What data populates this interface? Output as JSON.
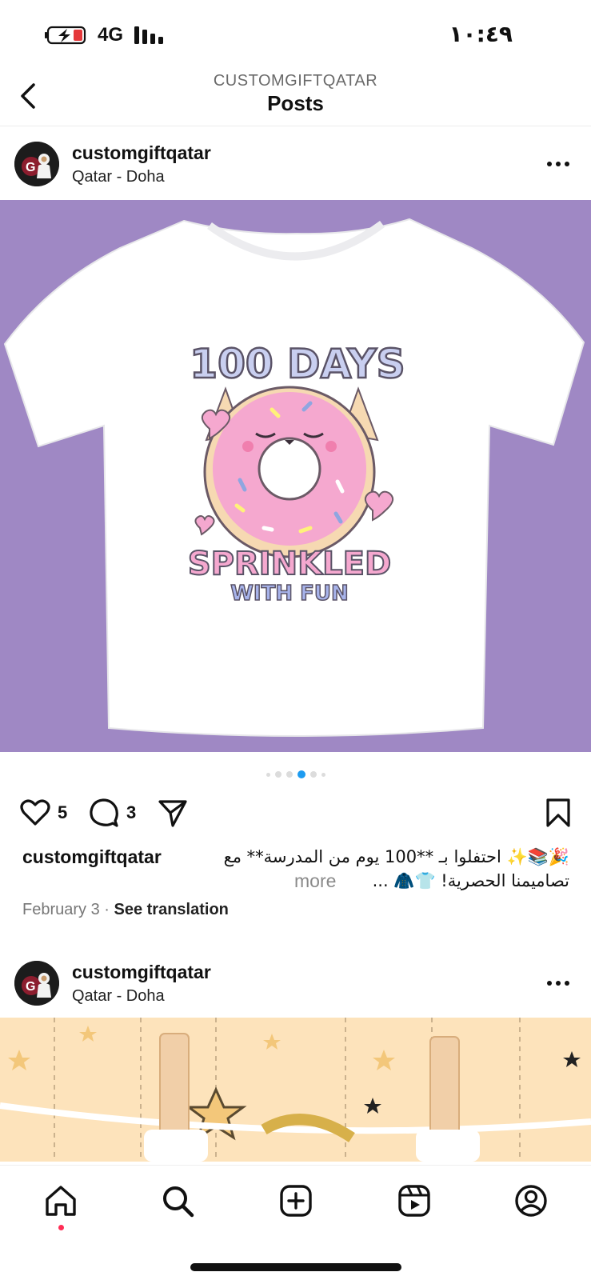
{
  "status": {
    "network": "4G",
    "time": "١٠:٤٩"
  },
  "header": {
    "account": "CUSTOMGIFTQATAR",
    "title": "Posts"
  },
  "posts": [
    {
      "username": "customgiftqatar",
      "location": "Qatar - Doha",
      "shirt_text": {
        "line1": "100 DAYS",
        "line2": "SPRINKLED",
        "line3": "WITH FUN"
      },
      "carousel": {
        "count": 6,
        "active_index": 3
      },
      "likes": "5",
      "comments": "3",
      "caption_user": "customgiftqatar",
      "caption_line1": "🎉📚✨ احتفلوا بـ **100 يوم من المدرسة** مع",
      "caption_line2": "تصاميمنا الحصرية! 👕🧥 ...",
      "caption_more": "more",
      "date": "February 3",
      "see_translation": "See translation"
    },
    {
      "username": "customgiftqatar",
      "location": "Qatar - Doha"
    }
  ],
  "colors": {
    "image_bg": "#9f88c4",
    "active_dot": "#1d9bf0",
    "notification_dot": "#ff2d55"
  },
  "nav": [
    "home-icon",
    "search-icon",
    "create-icon",
    "reels-icon",
    "profile-icon"
  ]
}
